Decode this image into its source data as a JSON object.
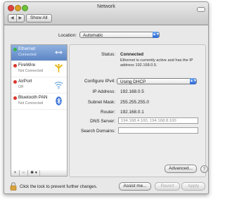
{
  "window": {
    "title": "Network"
  },
  "toolbar": {
    "back_label": "◀",
    "forward_label": "▶",
    "show_all_label": "Show All"
  },
  "location": {
    "label": "Location:",
    "value": "Automatic"
  },
  "services": [
    {
      "name": "Ethernet",
      "status": "Connected",
      "dot_color": "#39b54a",
      "icon": "ethernet-arrows-icon",
      "selected": true
    },
    {
      "name": "FireWire",
      "status": "Not Connected",
      "dot_color": "#d9372c",
      "icon": "firewire-icon",
      "selected": false
    },
    {
      "name": "AirPort",
      "status": "Off",
      "dot_color": "#d9372c",
      "icon": "wifi-icon",
      "selected": false
    },
    {
      "name": "Bluetooth PAN",
      "status": "Not Connected",
      "dot_color": "#d9372c",
      "icon": "bluetooth-icon",
      "selected": false
    }
  ],
  "sidebar_controls": {
    "add": "+",
    "remove": "−",
    "action": "✱ ▾"
  },
  "detail": {
    "status_label": "Status:",
    "status_value": "Connected",
    "status_note": "Ethernet is currently active and has the IP address 192.168.0.5.",
    "configure_label": "Configure IPv4:",
    "configure_value": "Using DHCP",
    "ip_label": "IP Address:",
    "ip_value": "192.168.0.5",
    "subnet_label": "Subnet Mask:",
    "subnet_value": "255.255.255.0",
    "router_label": "Router:",
    "router_value": "192.168.0.1",
    "dns_label": "DNS Server:",
    "dns_value": "194.168.4.100, 194.168.8.100",
    "search_label": "Search Domains:",
    "search_value": "",
    "advanced_label": "Advanced...",
    "help_label": "?"
  },
  "footer": {
    "lock_message": "Click the lock to prevent further changes.",
    "assist_label": "Assist me...",
    "revert_label": "Revert",
    "apply_label": "Apply"
  },
  "colors": {
    "accent": "#3c78d8",
    "connected": "#39b54a",
    "disconnected": "#d9372c"
  }
}
